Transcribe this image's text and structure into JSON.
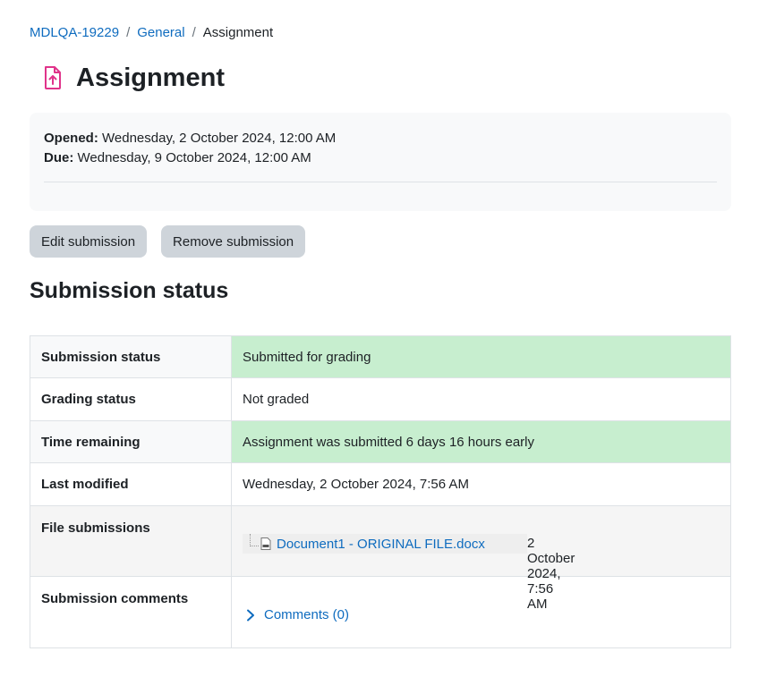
{
  "breadcrumb": {
    "items": [
      "MDLQA-19229",
      "General"
    ],
    "current": "Assignment",
    "separator": "/"
  },
  "page": {
    "title": "Assignment",
    "icon": "assignment-upload-icon"
  },
  "dates": {
    "opened_label": "Opened:",
    "opened_value": "Wednesday, 2 October 2024, 12:00 AM",
    "due_label": "Due:",
    "due_value": "Wednesday, 9 October 2024, 12:00 AM"
  },
  "actions": {
    "edit": "Edit submission",
    "remove": "Remove submission"
  },
  "section": {
    "heading": "Submission status"
  },
  "status_table": {
    "rows": [
      {
        "label": "Submission status",
        "value": "Submitted for grading"
      },
      {
        "label": "Grading status",
        "value": "Not graded"
      },
      {
        "label": "Time remaining",
        "value": "Assignment was submitted 6 days 16 hours early"
      },
      {
        "label": "Last modified",
        "value": "Wednesday, 2 October 2024, 7:56 AM"
      },
      {
        "label": "File submissions",
        "file_name": "Document1 - ORIGINAL FILE.docx",
        "file_date": "2 October 2024, 7:56 AM"
      },
      {
        "label": "Submission comments",
        "comments_link": "Comments (0)"
      }
    ]
  },
  "colors": {
    "link": "#0f6cbf",
    "success_bg": "#c7eecf",
    "icon_accent": "#e0338a",
    "button_bg": "#ced4da"
  }
}
